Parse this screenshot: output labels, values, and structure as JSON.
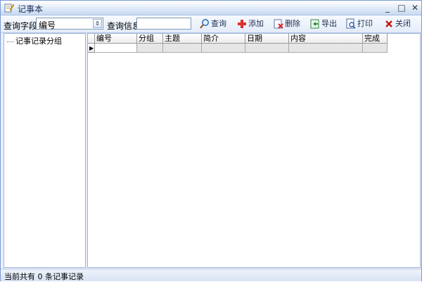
{
  "window": {
    "title": "记事本",
    "minimize_glyph": "_",
    "maximize_glyph": "□",
    "close_glyph": "✕"
  },
  "toolbar": {
    "query_field_label": "查询字段",
    "query_field_value": "编号",
    "query_info_label": "查询信息",
    "query_info_value": "",
    "buttons": {
      "query": "查询",
      "add": "添加",
      "delete": "删除",
      "export": "导出",
      "print": "打印",
      "close": "关闭"
    }
  },
  "sidebar": {
    "root_label": "记事记录分组"
  },
  "grid": {
    "columns": [
      "编号",
      "分组",
      "主题",
      "简介",
      "日期",
      "内容",
      "完成"
    ]
  },
  "status": {
    "text": "当前共有 0 条记事记录"
  },
  "colors": {
    "accent": "#7a9cd3",
    "toolbar_bg": "#e4ecf8",
    "row_bg": "#e6e6e6"
  },
  "icons": {
    "app": "notepad-pen-icon",
    "query": "magnifier-icon",
    "add": "plus-icon",
    "delete": "delete-icon",
    "export": "export-icon",
    "print": "print-preview-icon",
    "close": "x-close-icon"
  }
}
